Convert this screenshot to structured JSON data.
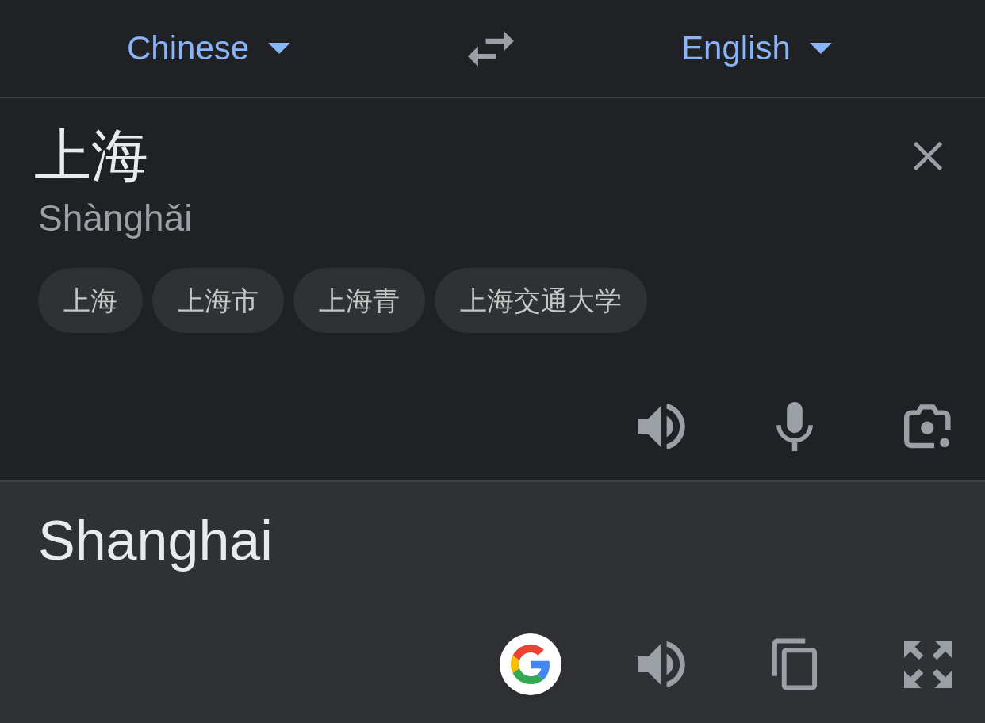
{
  "language_bar": {
    "source_language": {
      "label": "Chinese"
    },
    "target_language": {
      "label": "English"
    }
  },
  "input": {
    "text": "上海",
    "romanization": "Shànghǎi",
    "suggestions": [
      {
        "label": "上海"
      },
      {
        "label": "上海市"
      },
      {
        "label": "上海青"
      },
      {
        "label": "上海交通大学"
      }
    ]
  },
  "output": {
    "text": "Shanghai"
  }
}
